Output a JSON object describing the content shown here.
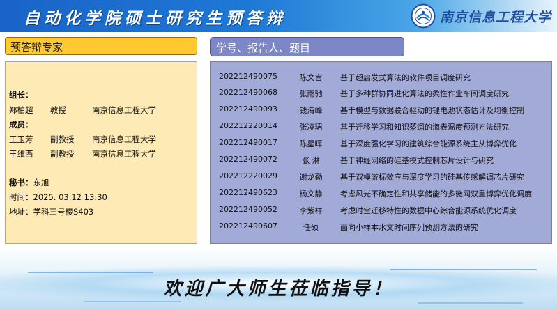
{
  "banner": {
    "title": "自动化学院硕士研究生预答辩",
    "university": "南京信息工程大学",
    "logo_icon": "university-seal-icon"
  },
  "committee": {
    "header": "预答辩专家",
    "leader_label": "组长：",
    "leader": {
      "name": "郑柏超",
      "title": "教授",
      "org": "南京信息工程大学"
    },
    "members_label": "成员：",
    "members": [
      {
        "name": "王玉芳",
        "title": "副教授",
        "org": "南京信息工程大学"
      },
      {
        "name": "王维西",
        "title": "副教授",
        "org": "南京信息工程大学"
      }
    ],
    "secretary_label": "秘书：",
    "secretary": "东旭",
    "time_label": "时间：",
    "time": "2025. 03.12  13:30",
    "place_label": "地址：",
    "place": "学科三号楼S403"
  },
  "reporters": {
    "header": "学号、报告人、题目",
    "rows": [
      {
        "id": "202212490075",
        "name": "陈文言",
        "topic": "基于超启发式算法的软件项目调度研究"
      },
      {
        "id": "202212490068",
        "name": "张雨驰",
        "topic": "基于多种群协同进化算法的柔性作业车间调度研究"
      },
      {
        "id": "202212490093",
        "name": "钱海峰",
        "topic": "基于模型与数据联合驱动的锂电池状态估计及均衡控制"
      },
      {
        "id": "202212220014",
        "name": "张凌珺",
        "topic": "基于迁移学习和知识蒸馏的海表温度预测方法研究"
      },
      {
        "id": "202212490017",
        "name": "陈星晖",
        "topic": "基于深度强化学习的建筑综合能源系统主从博弈优化"
      },
      {
        "id": "202212490072",
        "name": "张  淋",
        "topic": "基于神经网络的硅基模式控制芯片设计与研究"
      },
      {
        "id": "202212220029",
        "name": "谢龙勤",
        "topic": "基于双模游标效应与深度学习的硅基传感解调芯片研究"
      },
      {
        "id": "202212490623",
        "name": "杨文静",
        "topic": "考虑风光不确定性和共享储能的多微网双重博弈优化调度"
      },
      {
        "id": "202212490052",
        "name": "李紫祥",
        "topic": "考虑时空迁移特性的数据中心综合能源系统优化调度"
      },
      {
        "id": "202212490607",
        "name": "任硕",
        "topic": "面向小样本水文时间序列预测方法的研究"
      }
    ]
  },
  "footer": {
    "welcome": "欢迎广大师生莅临指导！"
  },
  "colors": {
    "banner_blue": "#1a63c7",
    "committee_header": "#ffc92f",
    "committee_panel": "#fdeab5",
    "reporters_header": "#7d86c7",
    "reporters_panel": "#a2aad8"
  }
}
